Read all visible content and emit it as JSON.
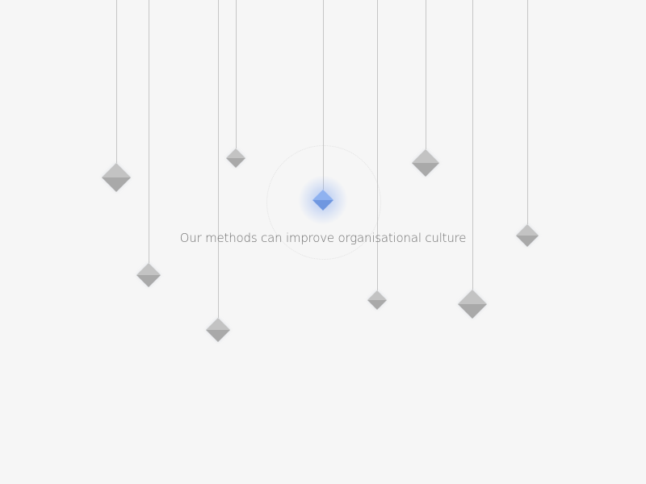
{
  "caption": "Our methods can improve organisational culture",
  "colors": {
    "background": "#f6f6f6",
    "string": "#c6c6c6",
    "gem_top": "#c3c3c3",
    "gem_bottom": "#a9a9a9",
    "active_top": "#8fb2f0",
    "active_bottom": "#6f97e0",
    "caption": "#6e6e6e"
  },
  "pendants": [
    {
      "icon": "diamond-icon",
      "active": false
    },
    {
      "icon": "diamond-icon",
      "active": false
    },
    {
      "icon": "diamond-icon",
      "active": false
    },
    {
      "icon": "diamond-icon",
      "active": false
    },
    {
      "icon": "diamond-icon",
      "active": true
    },
    {
      "icon": "diamond-icon",
      "active": false
    },
    {
      "icon": "diamond-icon",
      "active": false
    },
    {
      "icon": "diamond-icon",
      "active": false
    },
    {
      "icon": "diamond-icon",
      "active": false
    },
    {
      "icon": "diamond-icon",
      "active": false
    }
  ]
}
